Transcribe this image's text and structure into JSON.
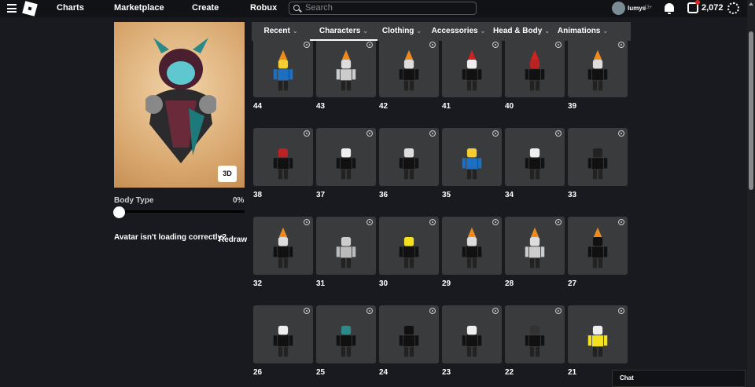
{
  "nav": {
    "charts": "Charts",
    "marketplace": "Marketplace",
    "create": "Create",
    "robux": "Robux",
    "search_placeholder": "Search",
    "username": "lumys",
    "age": "13+",
    "robux_count": "2,072"
  },
  "preview": {
    "view_button": "3D",
    "body_type_label": "Body Type",
    "body_type_value": "0%",
    "body_type_fraction": 0,
    "loading_question": "Avatar isn't loading correctly?",
    "redraw": "Redraw"
  },
  "tabs": [
    {
      "label": "Recent"
    },
    {
      "label": "Characters",
      "active": true
    },
    {
      "label": "Clothing"
    },
    {
      "label": "Accessories"
    },
    {
      "label": "Head & Body"
    },
    {
      "label": "Animations"
    }
  ],
  "items": [
    {
      "label": "44",
      "head": "#f5cd30",
      "body": "#1e6fbf",
      "hat": true
    },
    {
      "label": "43",
      "head": "#ddd",
      "body": "#ccc",
      "hat": true
    },
    {
      "label": "42",
      "head": "#ddd",
      "body": "#111",
      "hat": true
    },
    {
      "label": "41",
      "head": "#eee",
      "body": "#111",
      "hat": "#c22"
    },
    {
      "label": "40",
      "head": "#b22",
      "body": "#111",
      "hat": "#c22"
    },
    {
      "label": "39",
      "head": "#ddd",
      "body": "#111",
      "hat": true
    },
    {
      "label": "38",
      "head": "#b22",
      "body": "#111"
    },
    {
      "label": "37",
      "head": "#eee",
      "body": "#111"
    },
    {
      "label": "36",
      "head": "#ddd",
      "body": "#111"
    },
    {
      "label": "35",
      "head": "#f5cd30",
      "body": "#1e6fbf"
    },
    {
      "label": "34",
      "head": "#eee",
      "body": "#111"
    },
    {
      "label": "33",
      "head": "#222",
      "body": "#111"
    },
    {
      "label": "32",
      "head": "#ddd",
      "body": "#111",
      "hat": true
    },
    {
      "label": "31",
      "head": "#ccc",
      "body": "#bbb"
    },
    {
      "label": "30",
      "head": "#f5e020",
      "body": "#111"
    },
    {
      "label": "29",
      "head": "#ddd",
      "body": "#111",
      "hat": true
    },
    {
      "label": "28",
      "head": "#ddd",
      "body": "#ccc",
      "hat": true
    },
    {
      "label": "27",
      "head": "#111",
      "body": "#111",
      "hat": true
    },
    {
      "label": "26",
      "head": "#eee",
      "body": "#111"
    },
    {
      "label": "25",
      "head": "#2a8a8a",
      "body": "#111"
    },
    {
      "label": "24",
      "head": "#111",
      "body": "#111"
    },
    {
      "label": "23",
      "head": "#eee",
      "body": "#111"
    },
    {
      "label": "22",
      "head": "#333",
      "body": "#111"
    },
    {
      "label": "21",
      "head": "#eee",
      "body": "#f5e020"
    }
  ],
  "chat": "Chat"
}
